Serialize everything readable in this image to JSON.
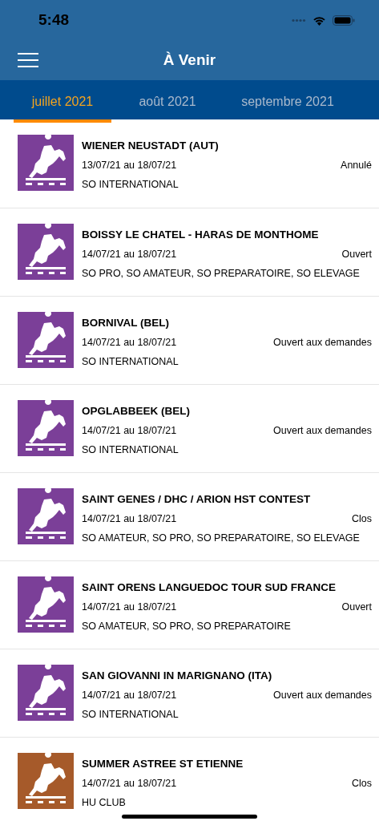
{
  "status_bar": {
    "time": "5:48"
  },
  "header": {
    "title": "À Venir"
  },
  "tabs": [
    {
      "label": "juillet 2021",
      "selected": true
    },
    {
      "label": "août 2021",
      "selected": false
    },
    {
      "label": "septembre 2021",
      "selected": false
    }
  ],
  "events": [
    {
      "name": "WIENER NEUSTADT (AUT)",
      "dates": "13/07/21 au 18/07/21",
      "status": "Annulé",
      "category": "SO INTERNATIONAL",
      "color": "#7b3f98"
    },
    {
      "name": "BOISSY LE CHATEL - HARAS DE MONTHOME",
      "dates": "14/07/21 au 18/07/21",
      "status": "Ouvert",
      "category": "SO PRO, SO AMATEUR, SO PREPARATOIRE, SO ELEVAGE",
      "color": "#7b3f98"
    },
    {
      "name": "BORNIVAL (BEL)",
      "dates": "14/07/21 au 18/07/21",
      "status": "Ouvert aux demandes",
      "category": "SO INTERNATIONAL",
      "color": "#7b3f98"
    },
    {
      "name": "OPGLABBEEK (BEL)",
      "dates": "14/07/21 au 18/07/21",
      "status": "Ouvert aux demandes",
      "category": "SO INTERNATIONAL",
      "color": "#7b3f98"
    },
    {
      "name": "SAINT GENES / DHC / ARION HST CONTEST",
      "dates": "14/07/21 au 18/07/21",
      "status": "Clos",
      "category": "SO AMATEUR, SO PRO, SO PREPARATOIRE, SO ELEVAGE",
      "color": "#7b3f98"
    },
    {
      "name": "SAINT ORENS LANGUEDOC TOUR SUD FRANCE",
      "dates": "14/07/21 au 18/07/21",
      "status": "Ouvert",
      "category": "SO AMATEUR, SO PRO, SO PREPARATOIRE",
      "color": "#7b3f98"
    },
    {
      "name": "SAN GIOVANNI IN MARIGNANO (ITA)",
      "dates": "14/07/21 au 18/07/21",
      "status": "Ouvert aux demandes",
      "category": "SO INTERNATIONAL",
      "color": "#7b3f98"
    },
    {
      "name": "SUMMER ASTREE ST ETIENNE",
      "dates": "14/07/21 au 18/07/21",
      "status": "Clos",
      "category": "HU CLUB",
      "color": "#a65a2a"
    }
  ]
}
